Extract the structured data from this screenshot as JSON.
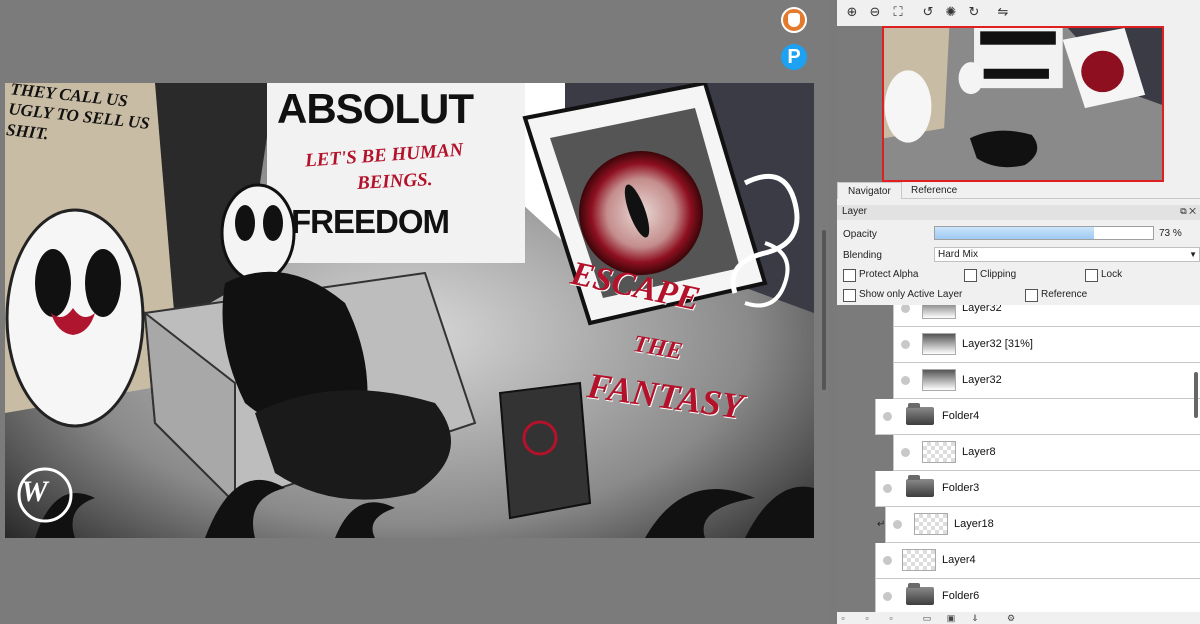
{
  "artwork": {
    "title_line1": "ABSOLUT",
    "title_line2": "FREEDOM",
    "red_line1": "LET'S BE HUMAN",
    "red_line2": "BEINGS.",
    "speech": "THEY CALL US UGLY TO SELL US SHIT.",
    "escape": "ESCAPE",
    "the": "THE",
    "fantasy": "FANTASY",
    "signature": "W"
  },
  "floating": {
    "pixiv_label": "P"
  },
  "navigator": {
    "toolbar_icons": [
      "zoom-in-icon",
      "zoom-out-icon",
      "fit-screen-icon",
      "rotate-left-icon",
      "reset-rotation-icon",
      "rotate-right-icon",
      "flip-horizontal-icon"
    ],
    "tabs": [
      "Navigator",
      "Reference"
    ]
  },
  "layer_panel": {
    "title": "Layer",
    "opacity_label": "Opacity",
    "opacity_value": "73 %",
    "opacity_fraction": 0.73,
    "blending_label": "Blending",
    "blending_value": "Hard Mix",
    "protect_alpha": "Protect Alpha",
    "clipping": "Clipping",
    "lock": "Lock",
    "show_only_active": "Show only Active Layer",
    "reference": "Reference",
    "layers": [
      {
        "name": "Layer32",
        "type": "layer",
        "level": 2
      },
      {
        "name": "Layer32 [31%]",
        "type": "layer",
        "level": 2
      },
      {
        "name": "Layer32",
        "type": "layer",
        "level": 2
      },
      {
        "name": "Folder4",
        "type": "folder",
        "level": 1
      },
      {
        "name": "Layer8",
        "type": "layer",
        "level": 2
      },
      {
        "name": "Folder3",
        "type": "folder",
        "level": 0
      },
      {
        "name": "Layer18",
        "type": "layer",
        "level": 1
      },
      {
        "name": "Layer4",
        "type": "layer",
        "level": 0
      },
      {
        "name": "Folder6",
        "type": "folder",
        "level": 0
      }
    ]
  }
}
